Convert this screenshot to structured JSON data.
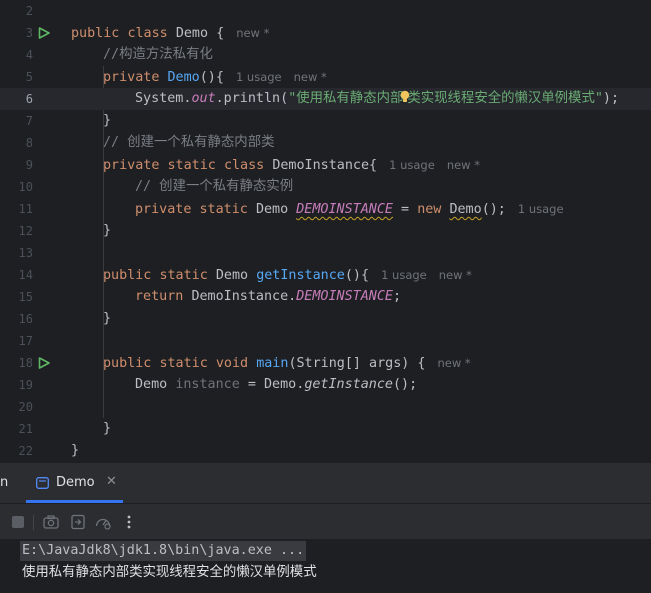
{
  "editor": {
    "lines": [
      {
        "n": "2"
      },
      {
        "n": "3",
        "k1": "public ",
        "k2": "class ",
        "name": "Demo {",
        "hint": "new *"
      },
      {
        "n": "4",
        "comment": "//构造方法私有化"
      },
      {
        "n": "5",
        "k1": "private ",
        "fn": "Demo",
        "rest": "(){",
        "hint_usage": "1 usage",
        "hint": "new *"
      },
      {
        "n": "6",
        "obj": "System.",
        "field": "out",
        "call": ".println(",
        "str_a": "\"使用私有静态内部",
        "str_b": "类实现线程安全的懒汉单例模式\"",
        "end": ");"
      },
      {
        "n": "7",
        "text": "}"
      },
      {
        "n": "8",
        "comment": "// 创建一个私有静态内部类"
      },
      {
        "n": "9",
        "k1": "private ",
        "k2": "static ",
        "k3": "class ",
        "name": "DemoInstance{",
        "hint_usage": "1 usage",
        "hint": "new *"
      },
      {
        "n": "10",
        "comment": "// 创建一个私有静态实例"
      },
      {
        "n": "11",
        "k1": "private ",
        "k2": "static ",
        "type": "Demo ",
        "field": "DEMOINSTANCE",
        "eq": " = ",
        "k3": "new ",
        "ctor": "Demo",
        "rest": "();",
        "hint_usage": "1 usage"
      },
      {
        "n": "12",
        "text": "}"
      },
      {
        "n": "13"
      },
      {
        "n": "14",
        "k1": "public ",
        "k2": "static ",
        "type": "Demo ",
        "fn": "getInstance",
        "rest": "(){",
        "hint_usage": "1 usage",
        "hint": "new *"
      },
      {
        "n": "15",
        "k1": "return ",
        "type": "DemoInstance.",
        "field": "DEMOINSTANCE",
        "rest": ";"
      },
      {
        "n": "16",
        "text": "}"
      },
      {
        "n": "17"
      },
      {
        "n": "18",
        "k1": "public ",
        "k2": "static ",
        "k3": "void ",
        "fn": "main",
        "rest": "(String[] args) {",
        "hint": "new *"
      },
      {
        "n": "19",
        "type": "Demo ",
        "var": "instance",
        "eq": " = Demo.",
        "call": "getInstance",
        "rest": "();"
      },
      {
        "n": "20"
      },
      {
        "n": "21",
        "text": "}"
      },
      {
        "n": "22",
        "text": "}"
      }
    ]
  },
  "run_panel": {
    "panel_title": "n",
    "tab_label": "Demo",
    "tab_close": "✕",
    "toolbar_icons": [
      "stop-icon",
      "camera-icon",
      "restore-layout-icon",
      "profiler-icon",
      "more-icon"
    ],
    "console": {
      "command": "E:\\JavaJdk8\\jdk1.8\\bin\\java.exe ...",
      "output": "使用私有静态内部类实现线程安全的懒汉单例模式"
    }
  },
  "colors": {
    "background": "#1e1f22",
    "keyword": "#cf8e6d",
    "function": "#56a8f5",
    "static_field": "#c77dbb",
    "string": "#6aab73",
    "comment": "#7a7e85",
    "run_gutter": "#5fb865",
    "tab_accent": "#3574f0"
  }
}
